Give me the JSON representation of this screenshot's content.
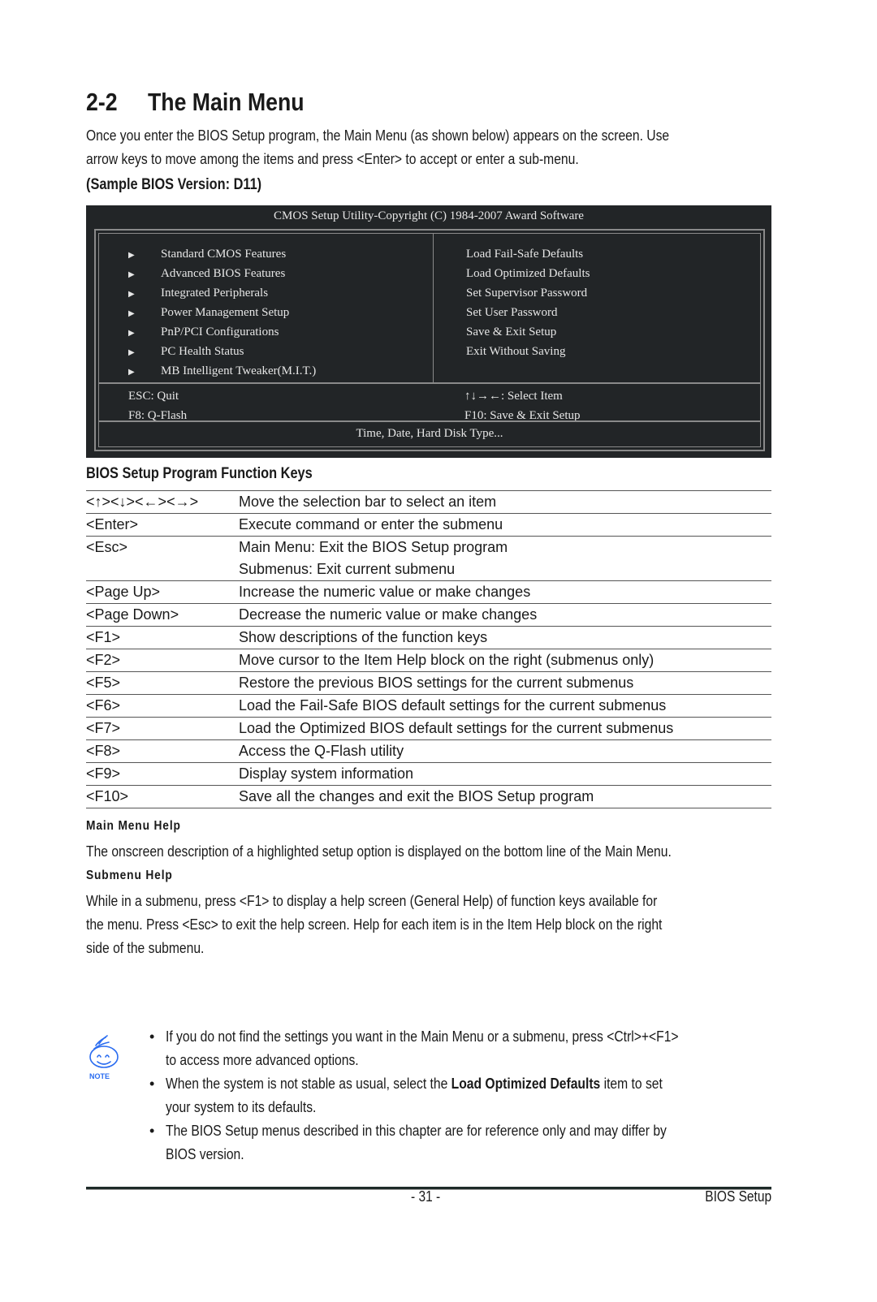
{
  "section": {
    "number": "2-2",
    "title": "The Main Menu"
  },
  "intro": {
    "line1": "Once you enter the BIOS Setup program, the Main Menu (as shown below) appears on the screen. Use",
    "line2": "arrow keys to move among the items and press <Enter> to accept or enter a sub-menu."
  },
  "sample_label": "(Sample BIOS Version: D11)",
  "bios_screen": {
    "header": "CMOS Setup Utility-Copyright (C) 1984-2007 Award Software",
    "left_items": [
      {
        "icon": "triangle-right-icon",
        "label": "Standard CMOS Features"
      },
      {
        "icon": "triangle-right-icon",
        "label": "Advanced BIOS Features"
      },
      {
        "icon": "triangle-right-icon",
        "label": "Integrated Peripherals"
      },
      {
        "icon": "triangle-right-icon",
        "label": "Power Management Setup"
      },
      {
        "icon": "triangle-right-icon",
        "label": "PnP/PCI Configurations"
      },
      {
        "icon": "triangle-right-icon",
        "label": "PC Health Status"
      },
      {
        "icon": "triangle-right-icon",
        "label": "MB Intelligent Tweaker(M.I.T.)"
      }
    ],
    "right_items": [
      "Load Fail-Safe Defaults",
      "Load Optimized Defaults",
      "Set Supervisor Password",
      "Set User Password",
      "Save & Exit Setup",
      "Exit Without Saving"
    ],
    "footer_left": [
      "ESC: Quit",
      "F8: Q-Flash"
    ],
    "footer_right": [
      "↑↓→←: Select Item",
      "F10: Save & Exit Setup"
    ],
    "hint": "Time, Date, Hard Disk Type..."
  },
  "function_keys": {
    "title": "BIOS Setup Program Function Keys",
    "rows": [
      {
        "key": "<↑><↓><←><→>",
        "desc": [
          "Move the selection bar to select an item"
        ]
      },
      {
        "key": "<Enter>",
        "desc": [
          "Execute command or enter the submenu"
        ]
      },
      {
        "key": "<Esc>",
        "desc": [
          "Main Menu: Exit the BIOS Setup program",
          "Submenus: Exit current submenu"
        ]
      },
      {
        "key": "<Page Up>",
        "desc": [
          "Increase the numeric value or make changes"
        ]
      },
      {
        "key": "<Page Down>",
        "desc": [
          "Decrease the numeric value or make changes"
        ]
      },
      {
        "key": "<F1>",
        "desc": [
          "Show descriptions of the function keys"
        ]
      },
      {
        "key": "<F2>",
        "desc": [
          "Move cursor to the Item Help block on the right (submenus only)"
        ]
      },
      {
        "key": "<F5>",
        "desc": [
          "Restore the previous BIOS settings for the current submenus"
        ]
      },
      {
        "key": "<F6>",
        "desc": [
          "Load the Fail-Safe BIOS default settings for the current submenus"
        ]
      },
      {
        "key": "<F7>",
        "desc": [
          "Load the Optimized BIOS default settings for the current submenus"
        ]
      },
      {
        "key": "<F8>",
        "desc": [
          "Access the Q-Flash utility"
        ]
      },
      {
        "key": "<F9>",
        "desc": [
          "Display system information"
        ]
      },
      {
        "key": "<F10>",
        "desc": [
          "Save all the changes and exit the BIOS Setup program"
        ]
      }
    ]
  },
  "main_menu_help": {
    "title": "Main Menu Help",
    "text": "The onscreen description of a highlighted setup option is displayed on the bottom line of the Main Menu."
  },
  "submenu_help": {
    "title": "Submenu Help",
    "lines": [
      "While in a submenu, press <F1> to display a help screen (General Help) of function keys available for",
      "the menu. Press <Esc> to exit the help screen. Help for each item is in the Item Help block on the right",
      "side of the submenu."
    ]
  },
  "note": {
    "icon": "smiley-note-icon",
    "icon_label": "NOTE",
    "icon_color": "#2a6cf0",
    "bullets": [
      {
        "lines": [
          "If you do not find the settings you want in the Main Menu or a submenu, press <Ctrl>+<F1>",
          "to access more advanced options."
        ]
      },
      {
        "prefix": "When the system is not stable as usual, select the ",
        "bold": "Load Optimized Defaults",
        "suffix": " item to set",
        "line2": "your system to its defaults."
      },
      {
        "lines": [
          "The BIOS Setup menus described in this chapter are for reference only and may differ by",
          "BIOS version."
        ]
      }
    ]
  },
  "footer": {
    "page": "- 31 -",
    "section": "BIOS Setup"
  }
}
